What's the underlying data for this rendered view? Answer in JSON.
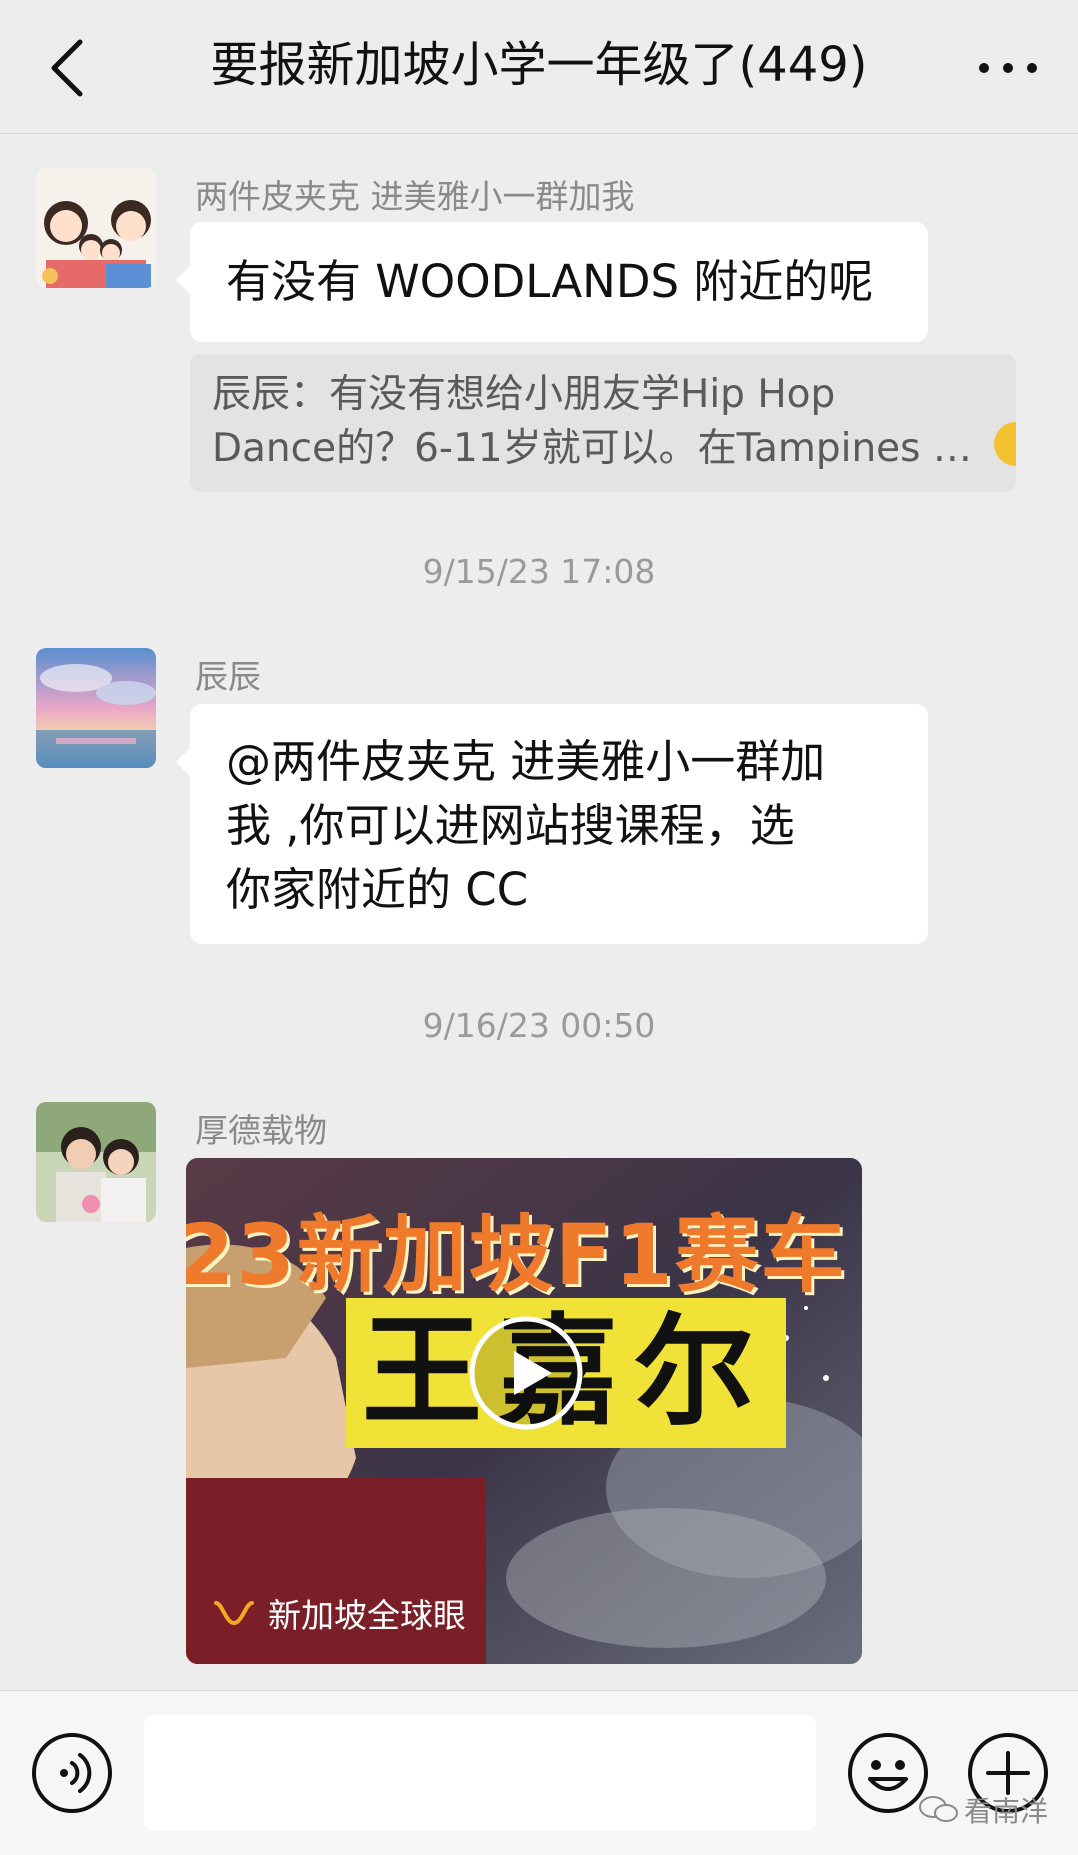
{
  "header": {
    "title": "要报新加坡小学一年级了(449)",
    "back_icon": "chevron-left-icon",
    "more_icon": "more-dots-icon"
  },
  "messages": [
    {
      "sender": "两件皮夹克 进美雅小一群加我",
      "text": "有没有 WOODLANDS 附近的呢",
      "quote_line1": "辰辰：有没有想给小朋友学Hip Hop",
      "quote_line2": "Dance的？6-11岁就可以。在Tampines …"
    },
    {
      "timestamp": "9/15/23 17:08",
      "sender": "辰辰",
      "text_line1": "@两件皮夹克 进美雅小一群加",
      "text_line2": "我 ,你可以进网站搜课程，选",
      "text_line3": "你家附近的 CC"
    },
    {
      "timestamp": "9/16/23 00:50",
      "sender": "厚德载物",
      "video": {
        "title_line1": "23新加坡F1赛车",
        "title_line2": "王嘉尔",
        "source": "新加坡全球眼"
      }
    }
  ],
  "input": {
    "placeholder": ""
  },
  "watermark": "看南洋",
  "colors": {
    "background": "#ededed",
    "bubble": "#ffffff",
    "quote": "#e3e3e3",
    "video_accent": "#f07a2b",
    "video_highlight": "#f1e237"
  }
}
